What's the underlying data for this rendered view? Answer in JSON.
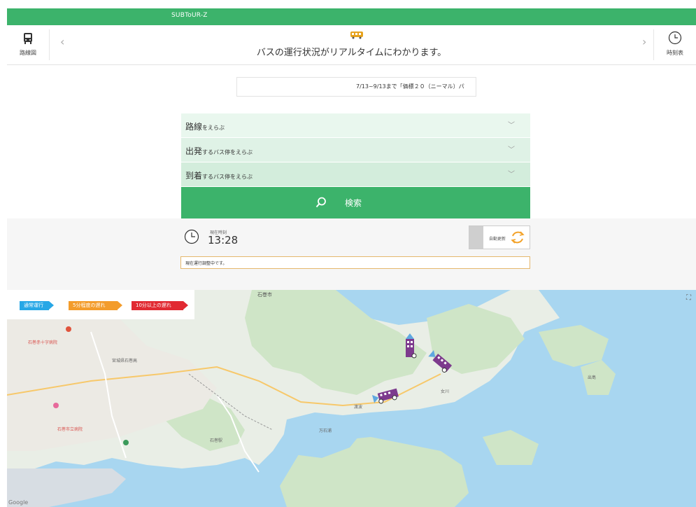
{
  "app": {
    "name": "SUBToUR-Z"
  },
  "header": {
    "left_button_label": "路線図",
    "right_button_label": "時刻表",
    "title": "バスの運行状況がリアルタイムにわかります。",
    "prev_icon": "chevron-left-icon",
    "next_icon": "chevron-right-icon"
  },
  "notice": {
    "text": "7/13~9/13まで「価標２０（ニーマル）パ"
  },
  "selectors": {
    "route": {
      "strong": "路線",
      "rest": "をえらぶ"
    },
    "departure": {
      "strong": "出発",
      "rest": "するバス停をえらぶ"
    },
    "arrival": {
      "strong": "到着",
      "rest": "するバス停をえらぶ"
    }
  },
  "search": {
    "label": "検索",
    "icon": "search-icon"
  },
  "status": {
    "time_label": "現在時刻",
    "time_value": "13:28",
    "auto_update_label": "自動更新",
    "message": "現在運行調整中です。"
  },
  "legend": {
    "normal": "通常運行",
    "delay_5": "5分程度の遅れ",
    "delay_10": "10分以上の遅れ"
  },
  "map": {
    "labels": {
      "ishinomaki_city": "石巻市",
      "hospital": "石巻赤十字病院",
      "school": "宮城県石巻高",
      "watanoha": "渡波",
      "mangokuura": "万石浦",
      "hospital2": "石巻市立病院",
      "ishinomaki_station": "石巻駅",
      "onagawa": "女川",
      "oshika": "出島"
    },
    "attribution": "Google"
  },
  "colors": {
    "brand_green": "#3cb36b",
    "legend_normal": "#27a7e6",
    "legend_delay5": "#f39c2b",
    "legend_delay10": "#e12a32",
    "bus_purple": "#7d3a8d",
    "sea": "#a8d6f0",
    "land": "#e7eee4"
  }
}
